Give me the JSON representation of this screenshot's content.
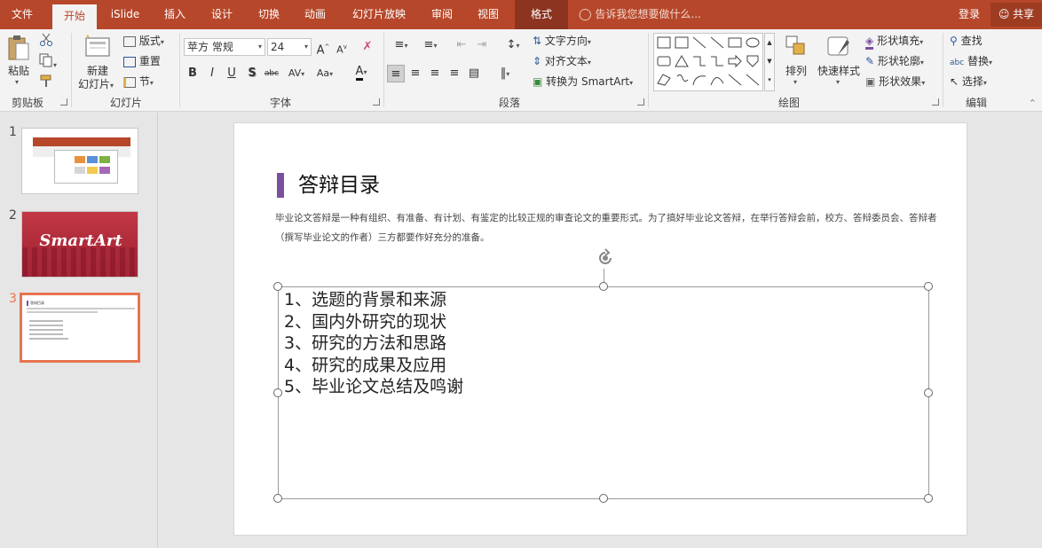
{
  "tabs": [
    "文件",
    "开始",
    "iSlide",
    "插入",
    "设计",
    "切换",
    "动画",
    "幻灯片放映",
    "审阅",
    "视图",
    "格式"
  ],
  "tell_me": "告诉我您想要做什么...",
  "login": "登录",
  "share": "共享",
  "ribbon": {
    "groups": [
      "剪贴板",
      "幻灯片",
      "字体",
      "段落",
      "绘图",
      "编辑"
    ],
    "clipboard": {
      "paste": "粘贴"
    },
    "slides": {
      "new_slide_1": "新建",
      "new_slide_2": "幻灯片",
      "layout": "版式",
      "reset": "重置",
      "section": "节"
    },
    "font": {
      "name": "苹方 常规",
      "size": "24"
    },
    "paragraph": {
      "text_direction": "文字方向",
      "align_text": "对齐文本",
      "convert_smartart": "转换为 SmartArt"
    },
    "drawing": {
      "arrange": "排列",
      "quick_styles": "快速样式",
      "shape_fill": "形状填充",
      "shape_outline": "形状轮廓",
      "shape_effects": "形状效果"
    },
    "editing": {
      "find": "查找",
      "replace": "替换",
      "select": "选择"
    }
  },
  "thumbnails": [
    {
      "num": "1",
      "label": ""
    },
    {
      "num": "2",
      "label": "SmartArt"
    },
    {
      "num": "3",
      "label": "答辩目录"
    }
  ],
  "slide": {
    "title": "答辩目录",
    "description": "毕业论文答辩是一种有组织、有准备、有计划、有鉴定的比较正规的审查论文的重要形式。为了搞好毕业论文答辩，在举行答辩会前，校方、答辩委员会、答辩者（撰写毕业论文的作者）三方都要作好充分的准备。",
    "items": [
      "1、选题的背景和来源",
      "2、国内外研究的现状",
      "3、研究的方法和思路",
      "4、研究的成果及应用",
      "5、毕业论文总结及鸣谢"
    ]
  },
  "colors": {
    "accent": "#b7472a",
    "title_bar": "#7b4fa0",
    "selected_thumb": "#e8734f"
  }
}
